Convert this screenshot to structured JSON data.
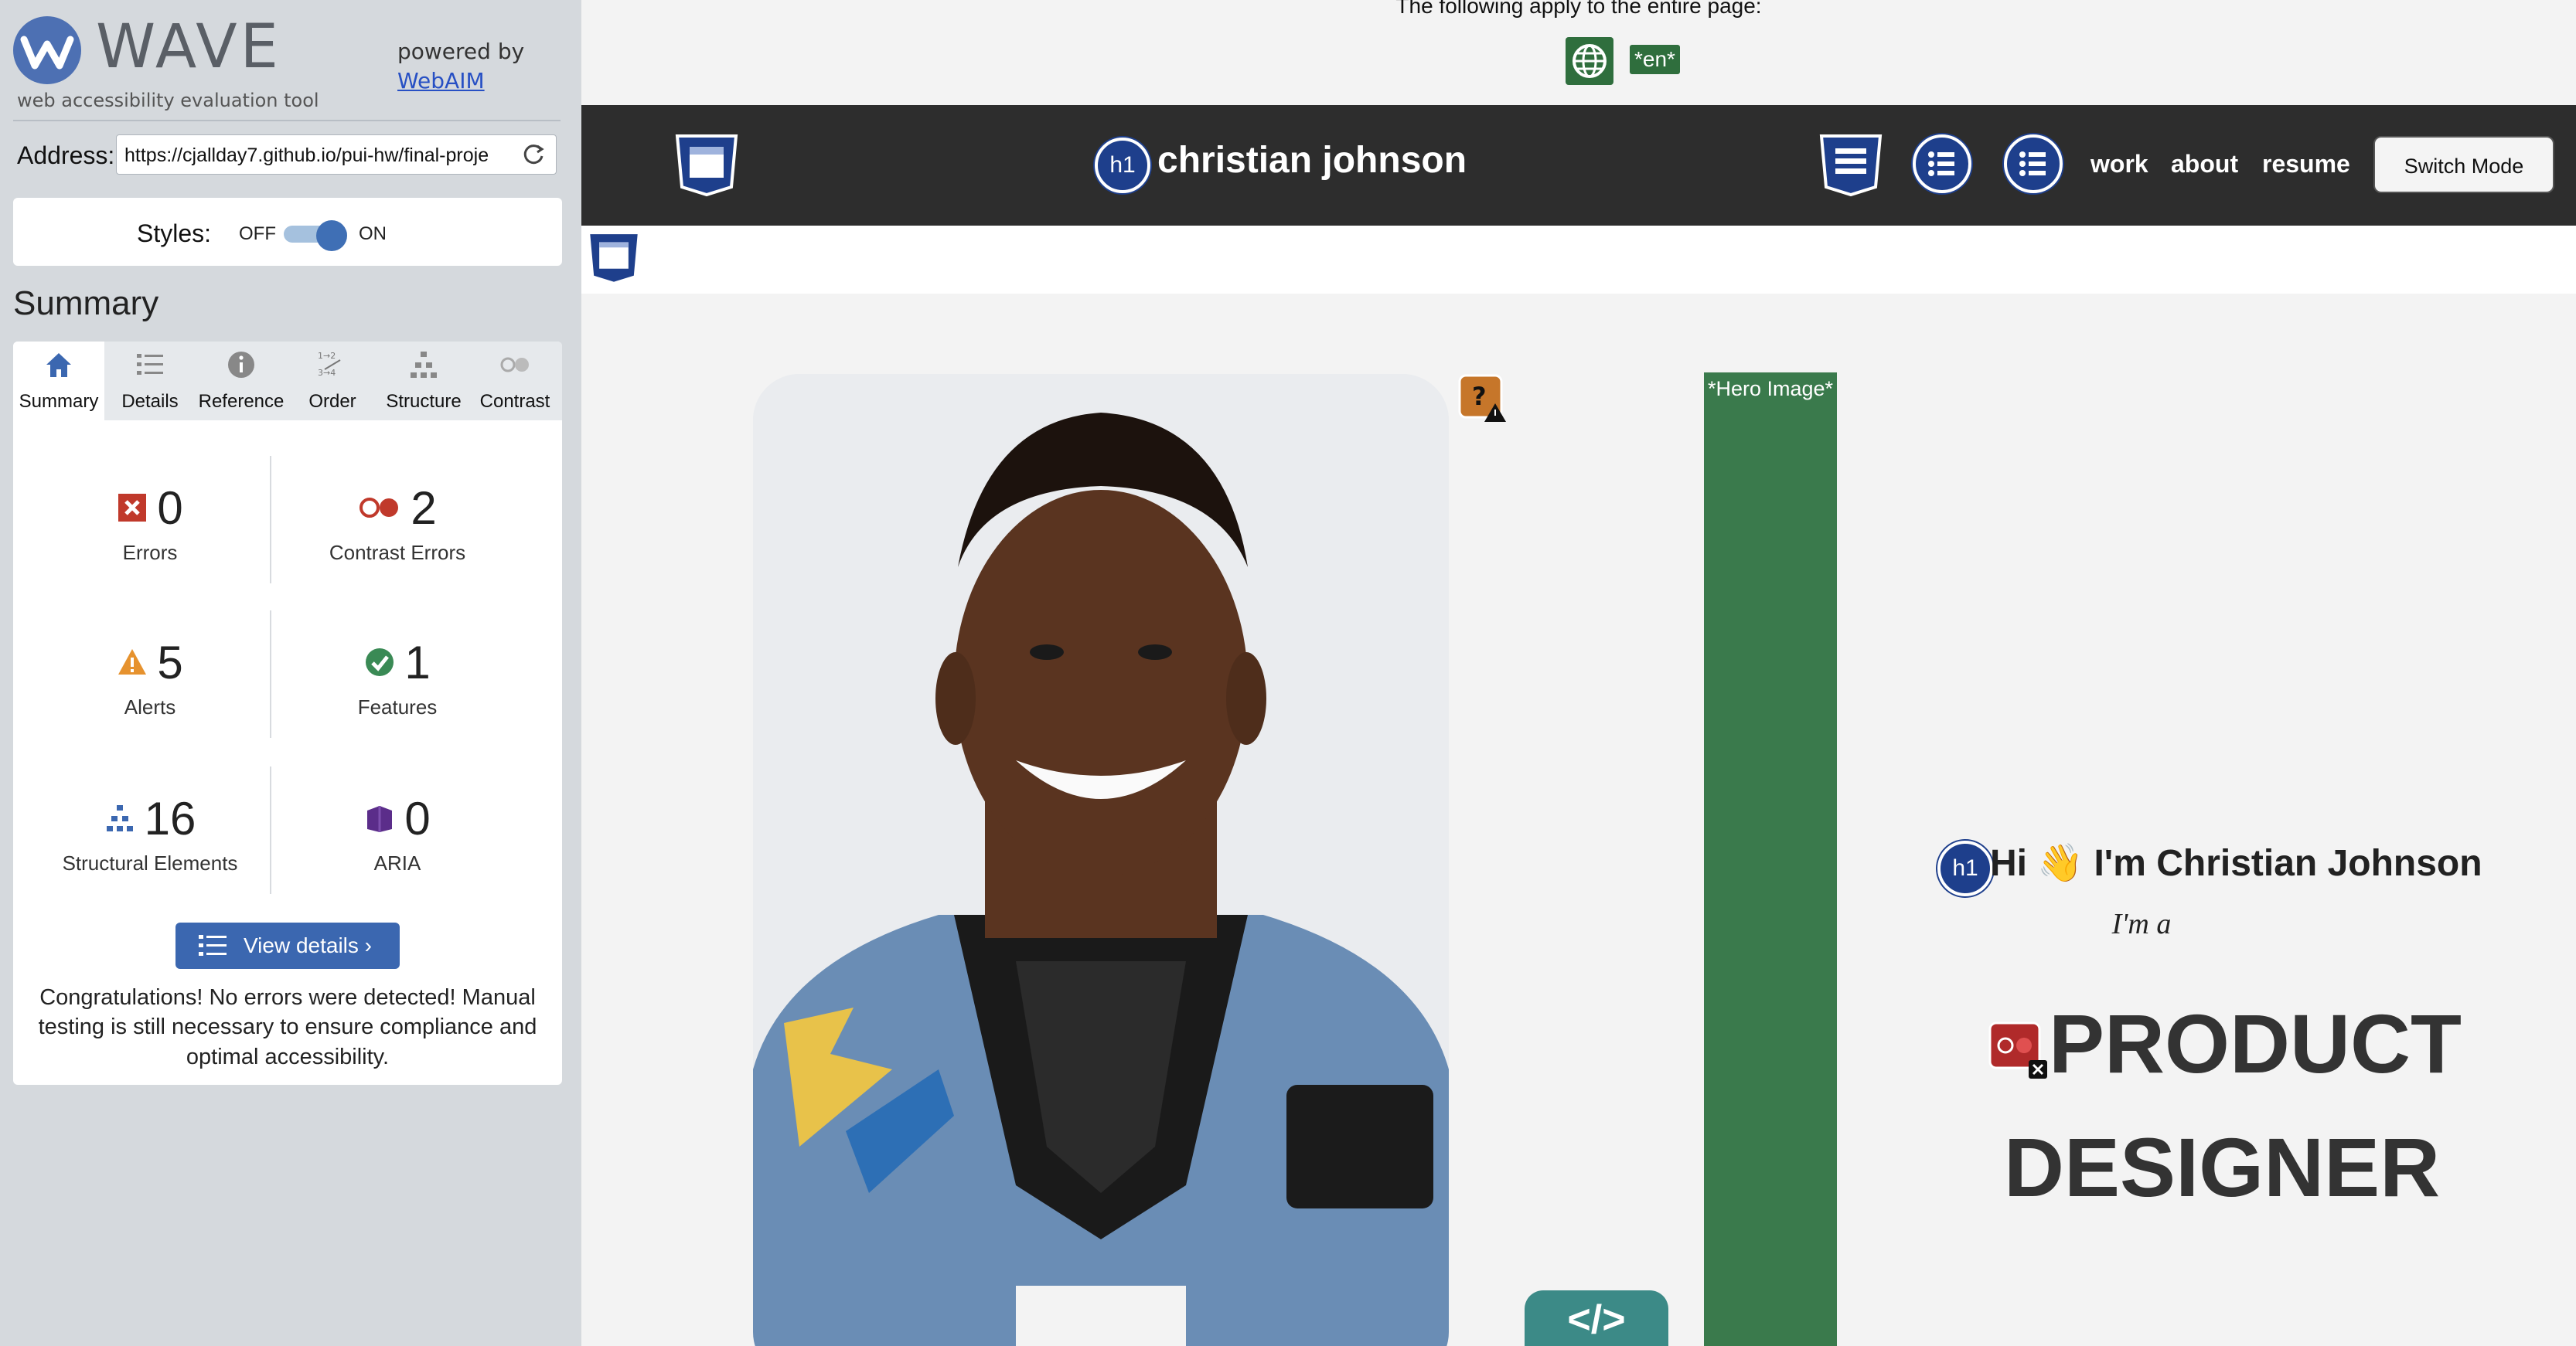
{
  "wave": {
    "logo_text": "WAVE",
    "tagline": "web accessibility evaluation tool",
    "powered_by": "powered by",
    "webaim_link": "WebAIM",
    "address_label": "Address:",
    "address_value": "https://cjallday7.github.io/pui-hw/final-proje",
    "styles_label": "Styles:",
    "styles_off": "OFF",
    "styles_on": "ON",
    "styles_enabled": true,
    "summary_heading": "Summary",
    "tabs": [
      {
        "label": "Summary",
        "icon": "home-icon",
        "active": true
      },
      {
        "label": "Details",
        "icon": "list-icon",
        "active": false
      },
      {
        "label": "Reference",
        "icon": "info-icon",
        "active": false
      },
      {
        "label": "Order",
        "icon": "order-icon",
        "active": false
      },
      {
        "label": "Structure",
        "icon": "structure-icon",
        "active": false
      },
      {
        "label": "Contrast",
        "icon": "contrast-icon",
        "active": false
      }
    ],
    "stats": {
      "errors": {
        "count": "0",
        "label": "Errors",
        "color": "#c0392b"
      },
      "contrast_errors": {
        "count": "2",
        "label": "Contrast Errors",
        "color": "#c0392b"
      },
      "alerts": {
        "count": "5",
        "label": "Alerts",
        "color": "#e6922e"
      },
      "features": {
        "count": "1",
        "label": "Features",
        "color": "#3a8a55"
      },
      "structural": {
        "count": "16",
        "label": "Structural Elements",
        "color": "#3b67b0"
      },
      "aria": {
        "count": "0",
        "label": "ARIA",
        "color": "#5b2d8a"
      }
    },
    "view_details": "View details ›",
    "congrats": "Congratulations! No errors were detected! Manual testing is still necessary to ensure compliance and optimal accessibility."
  },
  "page": {
    "applies_text": "The following apply to the entire page:",
    "lang_badge": "*en*",
    "brand_name": "christian johnson",
    "nav": [
      "work",
      "about",
      "resume"
    ],
    "switch_mode": "Switch Mode",
    "h1_badge": "h1",
    "hero_label": "*Hero Image*",
    "greeting": "Hi 👋 I'm Christian Johnson",
    "im_a": "I'm a",
    "role_line1": "PRODUCT",
    "role_line2": "DESIGNER",
    "code_badge": "</>",
    "colors": {
      "nav_bg": "#2d2d2d",
      "wave_blue": "#1e3f8c",
      "hero_green": "#3a7a4c"
    }
  }
}
